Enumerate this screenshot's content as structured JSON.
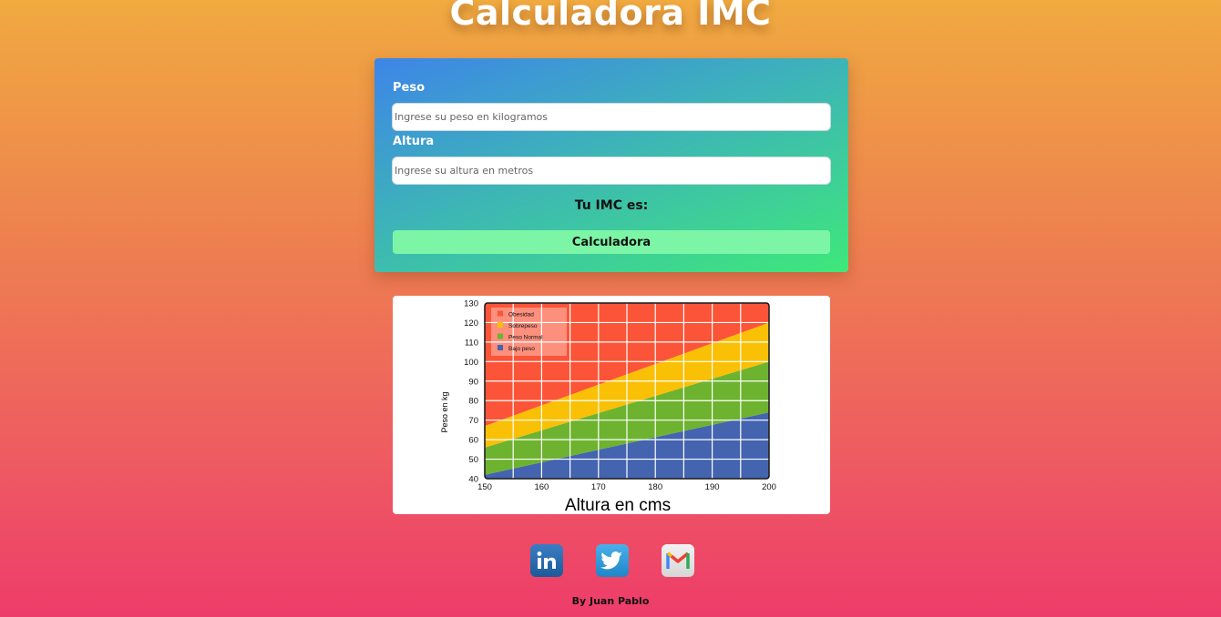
{
  "page": {
    "title": "Calculadora IMC"
  },
  "form": {
    "weight_label": "Peso",
    "weight_placeholder": "Ingrese su peso en kilogramos",
    "weight_value": "",
    "height_label": "Altura",
    "height_placeholder": "Ingrese su altura en metros",
    "height_value": "",
    "result_label": "Tu IMC es:",
    "submit_label": "Calculadora"
  },
  "social": [
    {
      "name": "linkedin-icon",
      "glyph": "in"
    },
    {
      "name": "twitter-icon",
      "glyph": "bird"
    },
    {
      "name": "gmail-icon",
      "glyph": "M"
    }
  ],
  "footer": {
    "text": "By Juan Pablo"
  },
  "chart_data": {
    "type": "area",
    "title": "",
    "xlabel": "Altura en cms",
    "ylabel": "Peso en kg",
    "xlim": [
      150,
      200
    ],
    "ylim": [
      40,
      130
    ],
    "x_ticks": [
      150,
      160,
      170,
      180,
      190,
      200
    ],
    "y_ticks": [
      40,
      50,
      60,
      70,
      80,
      90,
      100,
      110,
      120,
      130
    ],
    "grid": true,
    "legend_position": "top-left",
    "x": [
      150,
      200
    ],
    "series": [
      {
        "name": "Bajo peso",
        "color": "#4464b0",
        "lower": [
          40,
          40
        ],
        "upper": [
          42,
          74
        ]
      },
      {
        "name": "Peso Normal",
        "color": "#6db32f",
        "lower": [
          42,
          74
        ],
        "upper": [
          56,
          100
        ]
      },
      {
        "name": "Sobrepeso",
        "color": "#f9c005",
        "lower": [
          56,
          100
        ],
        "upper": [
          67,
          120
        ]
      },
      {
        "name": "Obesidad",
        "color": "#fc5438",
        "lower": [
          67,
          120
        ],
        "upper": [
          130,
          130
        ]
      }
    ],
    "legend_order": [
      "Obesidad",
      "Sobrepeso",
      "Peso Normal",
      "Bajo peso"
    ]
  }
}
